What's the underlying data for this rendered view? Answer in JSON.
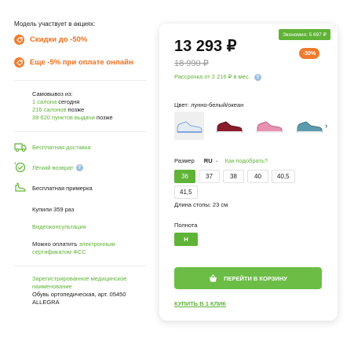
{
  "promotions": {
    "title": "Модель участвует в акциях:",
    "items": [
      {
        "label": "Скидки до -50%",
        "icon": "percent-badge-icon"
      },
      {
        "label": "Еще -5% при оплате онлайн",
        "icon": "percent-badge-icon"
      }
    ]
  },
  "pickup": {
    "title": "Самовывоз из:",
    "line1_link": "1 салона",
    "line1_rest": " сегодня",
    "line2_link": "216 салонов",
    "line2_rest": " позже",
    "line3_link": "39 620 пунктов выдачи",
    "line3_rest": " позже"
  },
  "features": {
    "delivery": "Бесплатная доставка",
    "return": "Лёгкий возврат",
    "fitting": "Бесплатная примерка",
    "info_glyph": "?"
  },
  "extra": {
    "bought": "Купили 359 раз",
    "video": "Видеоконсультация",
    "pay_text": "Можно оплатить ",
    "pay_link_1": "электронным",
    "pay_link_2": "сертификатом ФСС",
    "registered_1": "Зарегистрированное медицинское",
    "registered_2": "наименование",
    "product_name_1": "Обувь ортопедическая, арт. 05450",
    "product_name_2": "ALLEGRA"
  },
  "product": {
    "price": "13 293 ₽",
    "old_price": "18 990 ₽",
    "economy": "Экономия: 5 697 ₽",
    "discount": "-30%",
    "installment": "Рассрочка от 2 216 ₽ в мес.",
    "color_label": "Цвет: лунно-белый/океан",
    "thumbs": [
      {
        "name": "white-blue",
        "body": "#e4ebf2",
        "accent": "#7fa7d8"
      },
      {
        "name": "burgundy",
        "body": "#8a1c2b",
        "accent": "#5c0f1a"
      },
      {
        "name": "pink",
        "body": "#e792b3",
        "accent": "#c85f88"
      },
      {
        "name": "turquoise",
        "body": "#5c9cae",
        "accent": "#3e7585"
      }
    ],
    "next_arrow": "›",
    "size_label": "Размер",
    "size_system": "RU",
    "size_chevron": "⌄",
    "size_pick": "Как подобрать?",
    "sizes": [
      "36",
      "37",
      "38",
      "40",
      "40,5",
      "41,5"
    ],
    "foot_length": "Длина стопы: 23 см",
    "fullness_label": "Полнота",
    "fullness_value": "H",
    "cart_button": "ПЕРЕЙТИ В КОРЗИНУ",
    "one_click": "КУПИТЬ В 1 КЛИК"
  },
  "colors": {
    "green": "#5fb336",
    "orange": "#f07b2e"
  }
}
